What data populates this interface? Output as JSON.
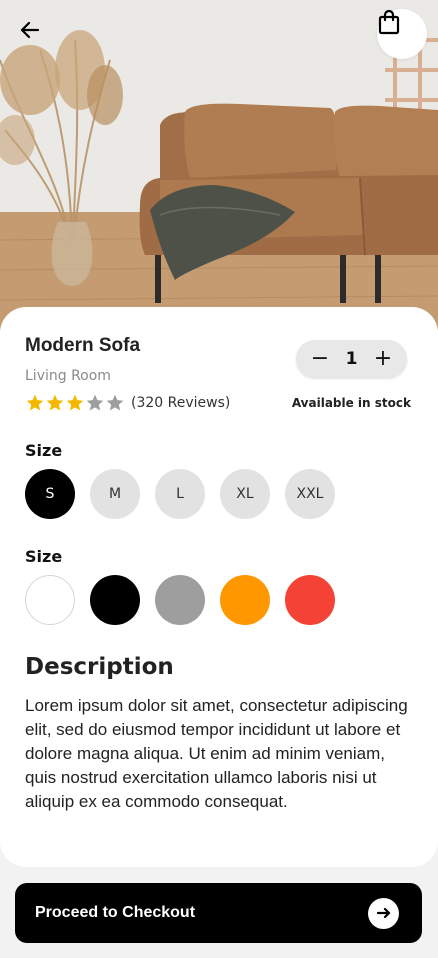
{
  "product": {
    "name": "Modern Sofa",
    "category": "Living Room",
    "rating": 3,
    "rating_max": 5,
    "reviews_text": "(320 Reviews)",
    "stock_text": "Available in stock"
  },
  "quantity": {
    "minus": "−",
    "value": "1",
    "plus": "+"
  },
  "sizes": {
    "label": "Size",
    "options": [
      "S",
      "M",
      "L",
      "XL",
      "XXL"
    ],
    "selected": "S"
  },
  "colors": {
    "label": "Size",
    "options": [
      "#ffffff",
      "#000000",
      "#9e9e9e",
      "#ff9800",
      "#f44336"
    ]
  },
  "description": {
    "title": "Description",
    "text": "Lorem ipsum dolor sit amet, consectetur adipiscing elit, sed do eiusmod tempor incididunt ut labore et dolore magna aliqua. Ut enim ad minim veniam, quis nostrud exercitation ullamco laboris nisi ut aliquip ex ea commodo consequat."
  },
  "checkout": {
    "label": "Proceed to Checkout"
  },
  "icons": {
    "back": "arrow-left-icon",
    "bag": "shopping-bag-icon",
    "star": "star-icon",
    "arrow": "arrow-right-icon"
  },
  "colors_theme": {
    "star_filled": "#f5b800",
    "star_empty": "#9e9e9e",
    "primary": "#000000"
  }
}
